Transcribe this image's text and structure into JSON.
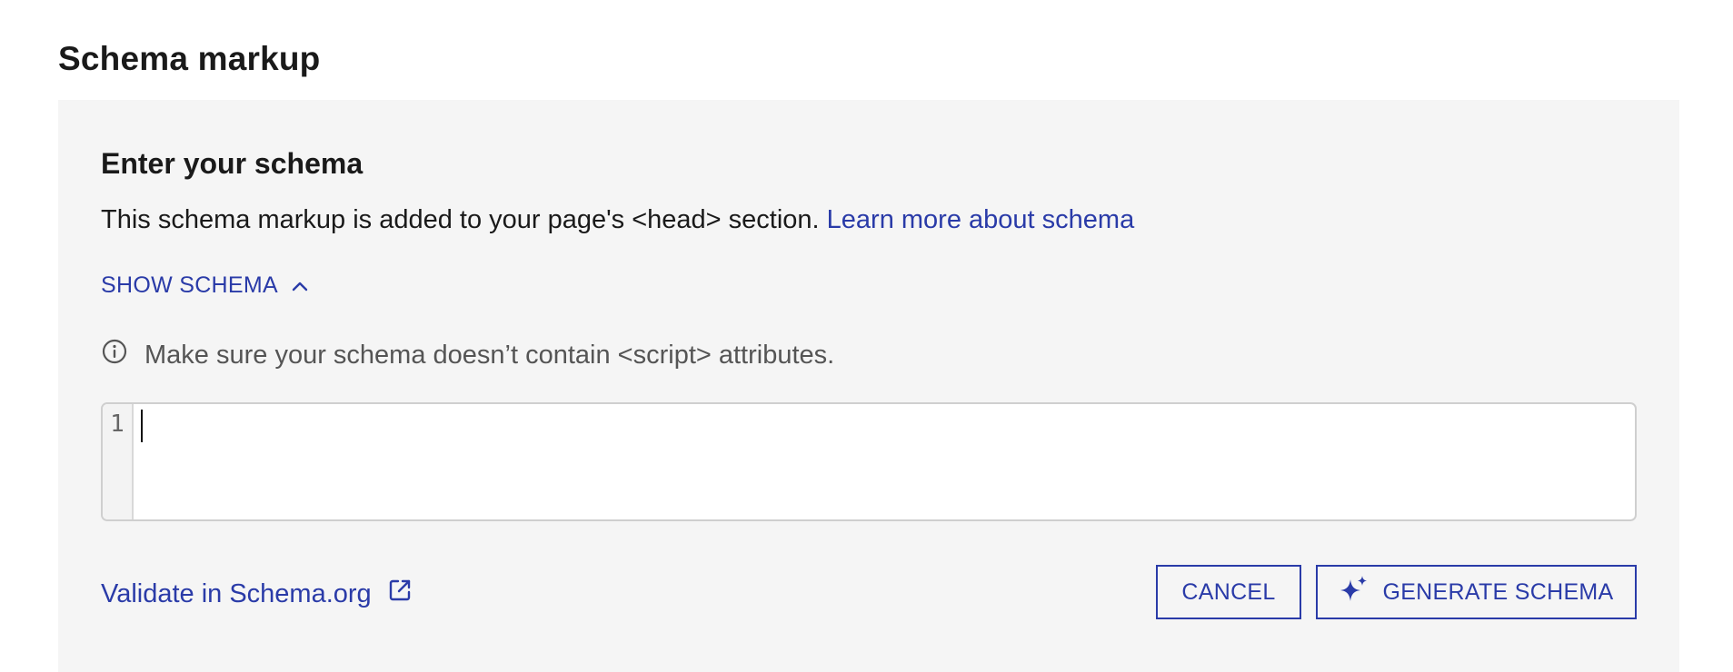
{
  "page": {
    "title": "Schema markup"
  },
  "section": {
    "title": "Enter your schema",
    "description": "This schema markup is added to your page's <head> section.",
    "learn_more_link": "Learn more about schema"
  },
  "toggle": {
    "label": "SHOW SCHEMA",
    "icon": "chevron-up-icon"
  },
  "info": {
    "icon": "info-circle-icon",
    "message": "Make sure your schema doesn’t contain <script> attributes."
  },
  "editor": {
    "line_numbers": [
      "1"
    ],
    "value": ""
  },
  "footer": {
    "validate_link": "Validate in Schema.org",
    "validate_icon": "external-link-icon",
    "cancel_label": "CANCEL",
    "generate_label": "GENERATE SCHEMA",
    "generate_icon": "sparkle-icon"
  },
  "colors": {
    "accent": "#2a3ba8",
    "panel": "#f5f5f5",
    "muted": "#555555"
  }
}
